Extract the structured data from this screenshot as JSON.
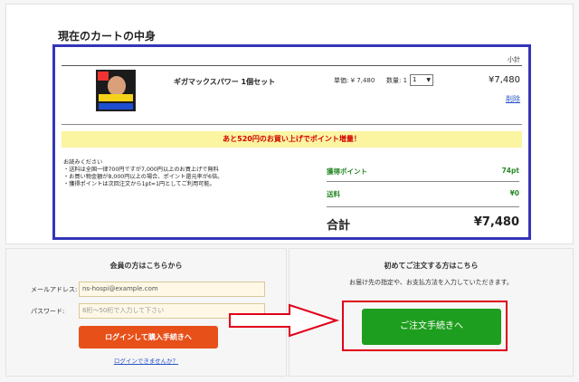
{
  "cart": {
    "title": "現在のカートの中身",
    "column_header": "小計",
    "item": {
      "name": "ギガマックスパワー 1個セット",
      "unit_price": "単価: ¥ 7,480",
      "qty_label": "数量: 1",
      "qty_value": "1",
      "line_total": "¥7,480",
      "delete_label": "削除"
    },
    "promo": "あと520円のお買い上げでポイント増量！",
    "notes": {
      "heading": "お読みください",
      "lines": [
        "送料は全国一律700円ですが7,000円以上のお買上げで無料",
        "お買い物金額が8,000円以上の場合、ポイント還元率が6倍。",
        "獲得ポイントは次回注文から1pt=1円としてご利用可能。"
      ]
    },
    "summary": {
      "points_label": "獲得ポイント",
      "points_value": "74pt",
      "shipping_label": "送料",
      "shipping_value": "¥0",
      "total_label": "合計",
      "total_value": "¥7,480"
    }
  },
  "login": {
    "title": "会員の方はこちらから",
    "email_label": "メールアドレス:",
    "email_value": "ns-hospi@example.com",
    "password_label": "パスワード:",
    "password_placeholder": "6桁～50桁で入力して下さい",
    "login_button": "ログインして購入手続きへ",
    "cant_login": "ログインできませんか？"
  },
  "new_customer": {
    "title": "初めてご注文する方はこちら",
    "description": "お届け先の指定や、お支払方法を入力していただきます。",
    "checkout_button": "ご注文手続きへ"
  },
  "colors": {
    "cart_box_border": "#3434b8",
    "promo_bg": "#fbf5a2",
    "promo_text": "#d40000",
    "summary_green": "#2a8a2a",
    "login_button": "#e8501a",
    "checkout_button": "#1e9e1e",
    "highlight_red": "#e0001a",
    "link_blue": "#2b54c9"
  }
}
